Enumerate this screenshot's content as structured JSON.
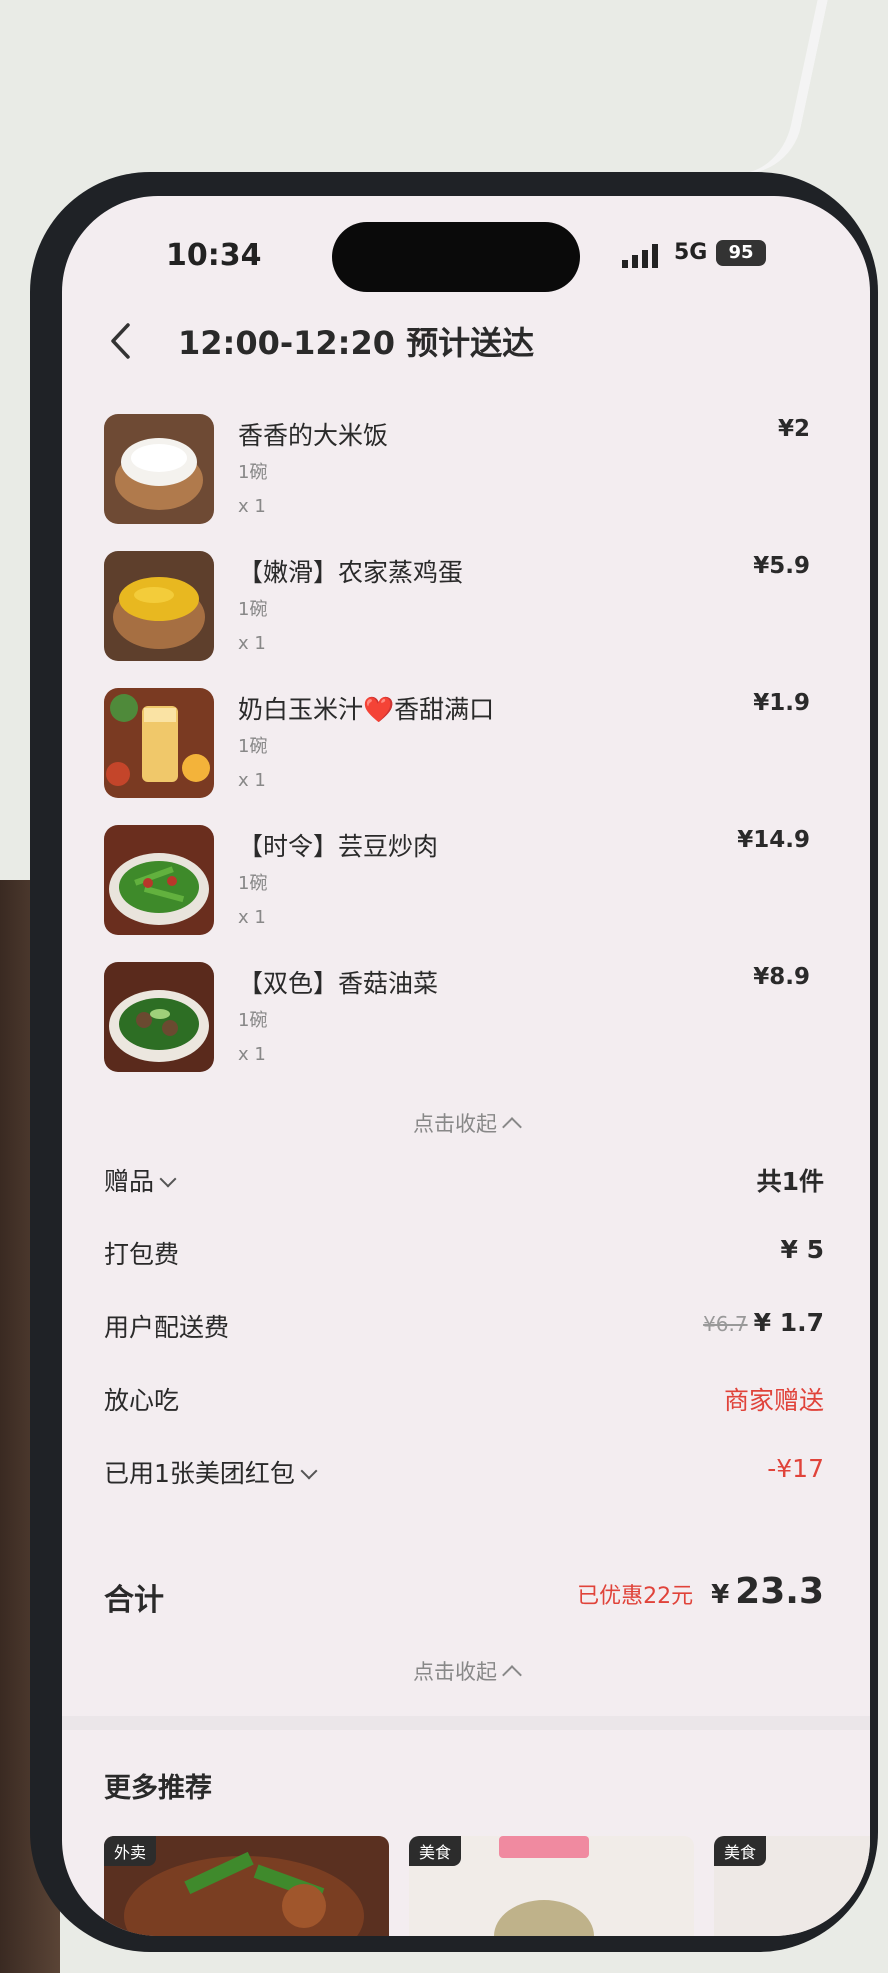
{
  "status_bar": {
    "time": "10:34",
    "network": "5G",
    "battery": "95"
  },
  "header": {
    "title": "12:00-12:20 预计送达"
  },
  "items": [
    {
      "name": "香香的大米饭",
      "spec": "1碗",
      "qty": "x 1",
      "price": "¥2"
    },
    {
      "name": "【嫩滑】农家蒸鸡蛋",
      "spec": "1碗",
      "qty": "x 1",
      "price": "¥5.9"
    },
    {
      "name": "奶白玉米汁❤️香甜满口",
      "spec": "1碗",
      "qty": "x 1",
      "price": "¥1.9"
    },
    {
      "name": "【时令】芸豆炒肉",
      "spec": "1碗",
      "qty": "x 1",
      "price": "¥14.9"
    },
    {
      "name": "【双色】香菇油菜",
      "spec": "1碗",
      "qty": "x 1",
      "price": "¥8.9"
    }
  ],
  "collapse_label": "点击收起",
  "fees": {
    "gift_label": "赠品",
    "gift_value": "共1件",
    "packing_label": "打包费",
    "packing_value": "¥ 5",
    "delivery_label": "用户配送费",
    "delivery_original": "¥6.7",
    "delivery_value": "¥ 1.7",
    "assured_label": "放心吃",
    "assured_value": "商家赠送",
    "coupon_label": "已用1张美团红包",
    "coupon_value": "-¥17"
  },
  "total": {
    "label": "合计",
    "discount": "已优惠22元",
    "currency": "¥",
    "amount": "23.3"
  },
  "recommend": {
    "title": "更多推荐",
    "tags": [
      "外卖",
      "美食",
      "美食"
    ]
  }
}
